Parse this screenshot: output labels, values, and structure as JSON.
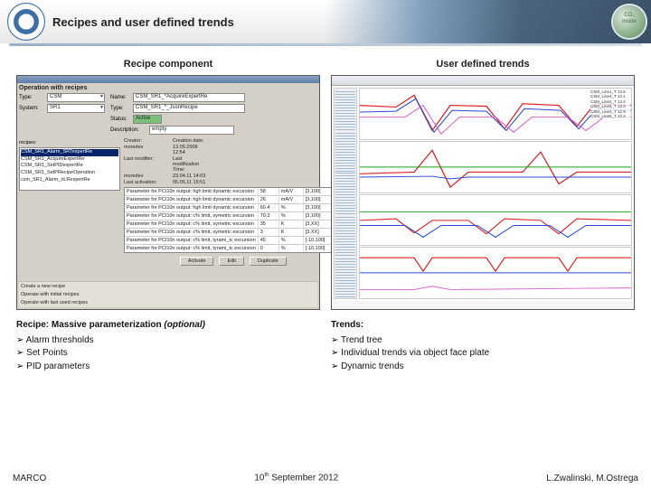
{
  "header": {
    "title": "Recipes and user defined trends"
  },
  "left": {
    "heading": "Recipe component",
    "panel_title": "Operation with recipes",
    "fields": {
      "type_label": "Type:",
      "type_value": "CSM",
      "name_label": "Name:",
      "name_value": "CSM_SR1_*AcquireExpertRe",
      "recipe_type_label": "Type:",
      "recipe_type_value": "CSM_SR1_*_JsonRecipe",
      "status_label": "Status:",
      "status_value": "Active",
      "system_label": "System:",
      "system_value": "SR1",
      "desc_label": "Description:",
      "desc_value": "empty",
      "recipes_label": "recipes:"
    },
    "recipes": [
      "CSM_SR1_Alarm_SRTexpertRe",
      "CSM_SR1_AcquireExpertRe",
      "CSM_SR1_SetPIDexpertRe",
      "CSM_SR1_SetPRecipeOperation",
      "csm_SR1_Alarm_nLRexpertRe"
    ],
    "meta": {
      "creator_label": "Creator:",
      "creator": "moredev",
      "creation_date_label": "Creation date:",
      "creation_date": "13.05.2008 12:54",
      "last_modifier_label": "Last modifier:",
      "last_modifier": "moredev",
      "last_modif_label": "Last modification Time:",
      "last_modif": "23.04.11 14:03",
      "last_activ_label": "Last activation:",
      "last_activ": "05.05.11 15:51"
    },
    "table": [
      {
        "param": "Parameter for PCI10n output: hgh limit dynamic excursion",
        "val": "58",
        "unit": "mA/V",
        "range": "[3,100]"
      },
      {
        "param": "Parameter for PCI10n output: hgh limit dynamic excursion",
        "val": "26",
        "unit": "mA/V",
        "range": "[3,100]"
      },
      {
        "param": "Parameter for PCI10n output: hgh limit dynamic excursion",
        "val": "60.4",
        "unit": "%",
        "range": "[3,100]"
      },
      {
        "param": "Parameter for PCI10n output: c% limit, symetric excursion",
        "val": "70.3",
        "unit": "%",
        "range": "[3,100]"
      },
      {
        "param": "Parameter for PCI10n output: c% limit, symetric excursion",
        "val": "35",
        "unit": "K",
        "range": "[3,XX]"
      },
      {
        "param": "Parameter for PCI10n output: c% limit, symetric excursion",
        "val": "3",
        "unit": "K",
        "range": "[3,XX]"
      },
      {
        "param": "Parameter for PCI10n output: c% limit, tyrami_tc excursion",
        "val": "45",
        "unit": "%",
        "range": "[-10,100]"
      },
      {
        "param": "Parameter for PCI10n output: c% limit, tyrami_tc excursion",
        "val": "0",
        "unit": "%",
        "range": "[-10,100]"
      }
    ],
    "buttons": {
      "activate": "Activate",
      "edit": "Edit",
      "duplicate": "Duplicate"
    },
    "footer": {
      "create_new": "Create a new recipe",
      "operate_initial": "Operate with initial recipes",
      "operate_last": "Operate with last used recipes"
    },
    "notes_title": "Recipe: Massive parameterization",
    "notes_opt": "(optional)",
    "bullets": [
      "Alarm thresholds",
      "Set Points",
      "PID parameters"
    ]
  },
  "right": {
    "heading": "User defined trends",
    "legend_rows": [
      [
        "CSM_Line1_T",
        "13.6",
        "CSM_Line4_T",
        "13.1"
      ],
      [
        "CSM_Line2_T",
        "13.2",
        "CSM_Line5_T",
        "13.0"
      ],
      [
        "CSM_Line3_T",
        "12.9",
        "CSM_Line6_T",
        "13.4"
      ]
    ],
    "notes_title": "Trends:",
    "bullets": [
      "Trend tree",
      "Individual trends via object face plate",
      "Dynamic trends"
    ]
  },
  "footer": {
    "left": "MARCO",
    "center_prefix": "10",
    "center_suffix": " September 2012",
    "center_super": "th",
    "right": "L.Zwalinski, M.Ostrega"
  }
}
